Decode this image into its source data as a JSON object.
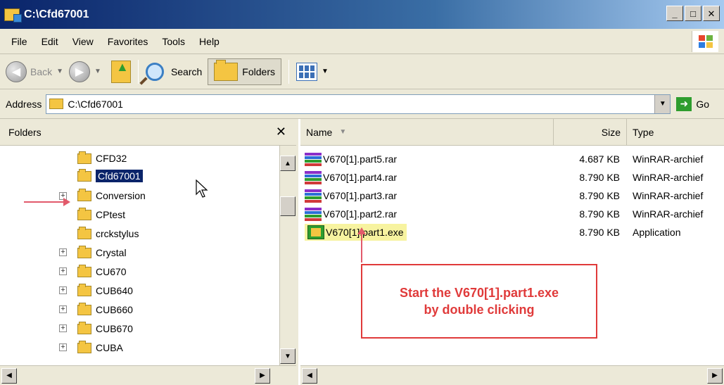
{
  "window": {
    "title": "C:\\Cfd67001"
  },
  "menu": [
    "File",
    "Edit",
    "View",
    "Favorites",
    "Tools",
    "Help"
  ],
  "toolbar": {
    "back_label": "Back",
    "search_label": "Search",
    "folders_label": "Folders"
  },
  "address": {
    "label": "Address",
    "value": "C:\\Cfd67001",
    "go_label": "Go"
  },
  "folders_pane": {
    "title": "Folders",
    "items": [
      {
        "label": "CFD32",
        "expandable": false,
        "selected": false
      },
      {
        "label": "Cfd67001",
        "expandable": false,
        "selected": true
      },
      {
        "label": "Conversion",
        "expandable": true,
        "selected": false
      },
      {
        "label": "CPtest",
        "expandable": false,
        "selected": false
      },
      {
        "label": "crckstylus",
        "expandable": false,
        "selected": false
      },
      {
        "label": "Crystal",
        "expandable": true,
        "selected": false
      },
      {
        "label": "CU670",
        "expandable": true,
        "selected": false
      },
      {
        "label": "CUB640",
        "expandable": true,
        "selected": false
      },
      {
        "label": "CUB660",
        "expandable": true,
        "selected": false
      },
      {
        "label": "CUB670",
        "expandable": true,
        "selected": false
      },
      {
        "label": "CUBA",
        "expandable": true,
        "selected": false
      }
    ]
  },
  "files_pane": {
    "columns": {
      "name": "Name",
      "size": "Size",
      "type": "Type"
    },
    "files": [
      {
        "name": "V670[1].part5.rar",
        "size": "4.687 KB",
        "type": "WinRAR-archief",
        "icon": "winrar-icon"
      },
      {
        "name": "V670[1].part4.rar",
        "size": "8.790 KB",
        "type": "WinRAR-archief",
        "icon": "winrar-icon"
      },
      {
        "name": "V670[1].part3.rar",
        "size": "8.790 KB",
        "type": "WinRAR-archief",
        "icon": "winrar-icon"
      },
      {
        "name": "V670[1].part2.rar",
        "size": "8.790 KB",
        "type": "WinRAR-archief",
        "icon": "winrar-icon"
      },
      {
        "name": "V670[1].part1.exe",
        "size": "8.790 KB",
        "type": "Application",
        "icon": "exe-icon"
      }
    ]
  },
  "annotation": {
    "text": "Start the V670[1].part1.exe by double clicking",
    "color": "#e03a3a"
  },
  "colors": {
    "title_bar": "#0a246a",
    "selection": "#0a246a",
    "highlight": "#f7f3a0",
    "arrow": "#e25a6b"
  }
}
